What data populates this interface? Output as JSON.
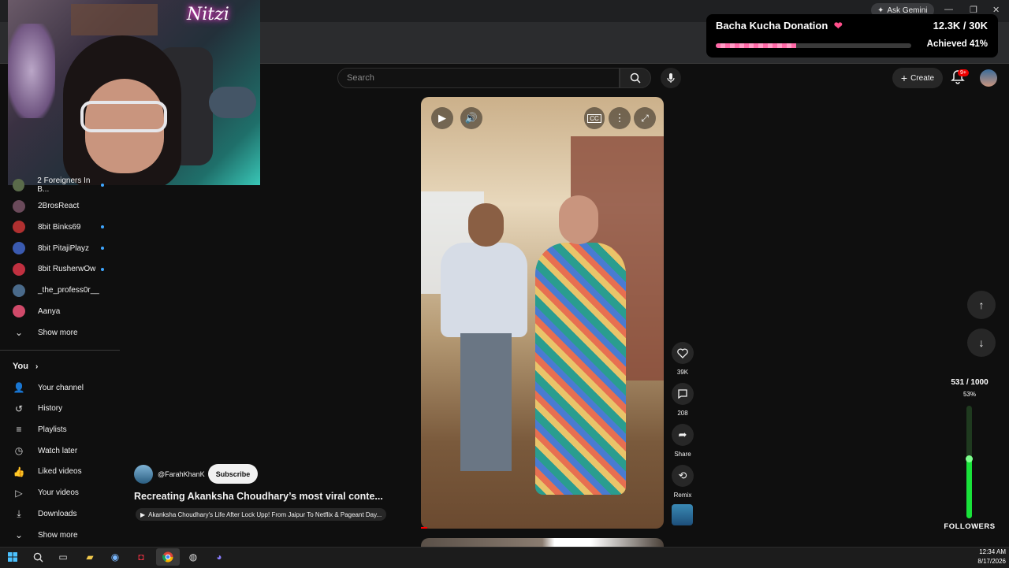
{
  "browser": {
    "ask_gemini": "Ask Gemini"
  },
  "webcam": {
    "logo_text": "Nitzi"
  },
  "sidebar": {
    "subscriptions": [
      {
        "label": "2 Foreigners In B...",
        "dot": true,
        "color": "#5a6b4a"
      },
      {
        "label": "2BrosReact",
        "dot": false,
        "color": "#6a4a5a"
      },
      {
        "label": "8bit Binks69",
        "dot": true,
        "color": "#b03030"
      },
      {
        "label": "8bit PitajiPlayz",
        "dot": true,
        "color": "#3a5ab0"
      },
      {
        "label": "8bit RusherwOw",
        "dot": true,
        "color": "#c03040"
      },
      {
        "label": "_the_profess0r__",
        "dot": false,
        "color": "#4a6a8a"
      },
      {
        "label": "Aanya",
        "dot": false,
        "color": "#d04a6a"
      }
    ],
    "show_more_1": "Show more",
    "you_heading": "You",
    "you_items": [
      {
        "label": "Your channel",
        "icon": "person-icon"
      },
      {
        "label": "History",
        "icon": "history-icon"
      },
      {
        "label": "Playlists",
        "icon": "playlist-icon"
      },
      {
        "label": "Watch later",
        "icon": "clock-icon"
      },
      {
        "label": "Liked videos",
        "icon": "thumbs-up-icon"
      },
      {
        "label": "Your videos",
        "icon": "video-icon"
      },
      {
        "label": "Downloads",
        "icon": "download-icon"
      }
    ],
    "show_more_2": "Show more"
  },
  "header": {
    "search_placeholder": "Search",
    "create_label": "Create",
    "notification_badge": "9+"
  },
  "short": {
    "likes": "39K",
    "comments": "208",
    "share_label": "Share",
    "remix_label": "Remix",
    "channel_handle": "@FarahKhanK",
    "subscribe_label": "Subscribe",
    "title": "Recreating Akanksha Choudhary’s most viral conte...",
    "related_video": "Akanksha Choudhary's Life After Lock Upp! From Jaipur To Netflix & Pageant Day..."
  },
  "donation": {
    "title": "Bacha Kucha Donation",
    "amount": "12.3K / 30K",
    "achieved": "Achieved 41%",
    "progress": 0.41,
    "accent": "#ff6aa8"
  },
  "followers_goal": {
    "count": "531 / 1000",
    "percent": "53%",
    "label": "FOLLOWERS",
    "progress": 0.53,
    "accent": "#19e23a"
  },
  "taskbar": {
    "time": "12:34 AM",
    "date": "8/17/2026"
  }
}
